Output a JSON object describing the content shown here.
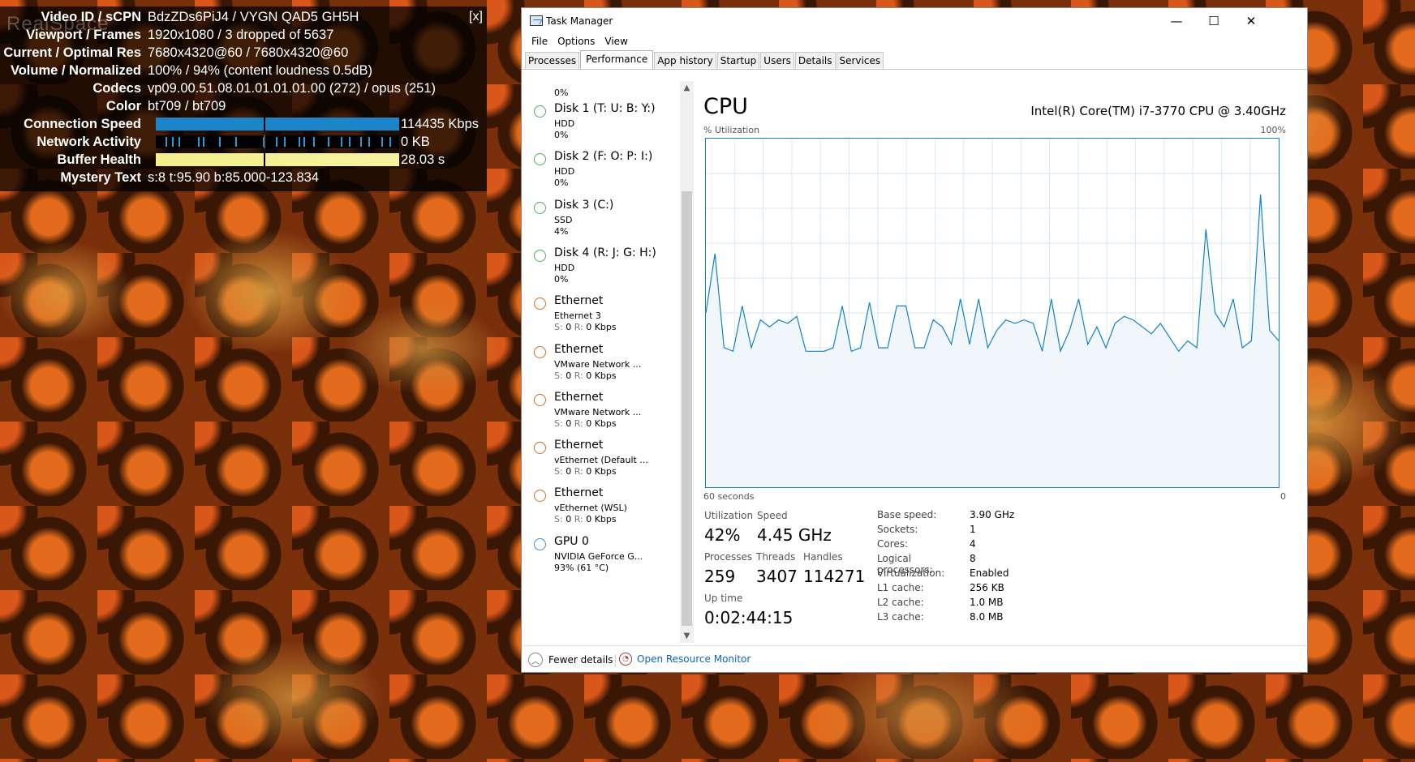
{
  "stats": {
    "ghost_text": "RealSpace",
    "close_label": "[x]",
    "rows": [
      {
        "label": "Video ID / sCPN",
        "value": "BdzZDs6PiJ4 / VYGN QAD5 GH5H"
      },
      {
        "label": "Viewport / Frames",
        "value": "1920x1080 / 3 dropped of 5637"
      },
      {
        "label": "Current / Optimal Res",
        "value": "7680x4320@60 / 7680x4320@60"
      },
      {
        "label": "Volume / Normalized",
        "value": "100% / 94% (content loudness 0.5dB)"
      },
      {
        "label": "Codecs",
        "value": "vp09.00.51.08.01.01.01.01.00 (272) / opus (251)"
      },
      {
        "label": "Color",
        "value": "bt709 / bt709"
      }
    ],
    "connection_speed": {
      "label": "Connection Speed",
      "value": "114435 Kbps"
    },
    "network_activity": {
      "label": "Network Activity",
      "value": "0 KB"
    },
    "buffer_health": {
      "label": "Buffer Health",
      "value": "28.03 s"
    },
    "mystery_text": {
      "label": "Mystery Text",
      "value": "s:8 t:95.90 b:85.000-123.834"
    },
    "colors": {
      "connection": "#1a86c9",
      "buffer": "#f2ef8a"
    }
  },
  "taskmanager": {
    "title": "Task Manager",
    "window_buttons": {
      "minimize": "—",
      "maximize": "☐",
      "close": "✕"
    },
    "menu": [
      "File",
      "Options",
      "View"
    ],
    "tabs": [
      {
        "label": "Processes",
        "active": false
      },
      {
        "label": "Performance",
        "active": true
      },
      {
        "label": "App history",
        "active": false
      },
      {
        "label": "Startup",
        "active": false
      },
      {
        "label": "Users",
        "active": false
      },
      {
        "label": "Details",
        "active": false
      },
      {
        "label": "Services",
        "active": false
      }
    ],
    "sidebar": {
      "top_value": "0%",
      "items": [
        {
          "name": "Disk 1 (T: U: B: Y:)",
          "sub": "HDD",
          "sub2": "0%",
          "color": "#4caf50"
        },
        {
          "name": "Disk 2 (F: O: P: I:)",
          "sub": "HDD",
          "sub2": "0%",
          "color": "#4caf50"
        },
        {
          "name": "Disk 3 (C:)",
          "sub": "SSD",
          "sub2": "4%",
          "color": "#4caf50"
        },
        {
          "name": "Disk 4 (R: J: G: H:)",
          "sub": "HDD",
          "sub2": "0%",
          "color": "#4caf50"
        },
        {
          "name": "Ethernet",
          "sub": "Ethernet 3",
          "sub2": "S: 0 R: 0 Kbps",
          "color": "#c8702a"
        },
        {
          "name": "Ethernet",
          "sub": "VMware Network ...",
          "sub2": "S: 0 R: 0 Kbps",
          "color": "#c8702a"
        },
        {
          "name": "Ethernet",
          "sub": "VMware Network ...",
          "sub2": "S: 0 R: 0 Kbps",
          "color": "#c8702a"
        },
        {
          "name": "Ethernet",
          "sub": "vEthernet (Default ...",
          "sub2": "S: 0 R: 0 Kbps",
          "color": "#c8702a"
        },
        {
          "name": "Ethernet",
          "sub": "vEthernet (WSL)",
          "sub2": "S: 0 R: 0 Kbps",
          "color": "#c8702a"
        },
        {
          "name": "GPU 0",
          "sub": "NVIDIA GeForce G...",
          "sub2": "93% (61 °C)",
          "color": "#3a8fd6"
        }
      ]
    },
    "cpu": {
      "title": "CPU",
      "model": "Intel(R) Core(TM) i7-3770 CPU @ 3.40GHz",
      "util_label": "% Utilization",
      "util_max": "100%",
      "axis_left": "60 seconds",
      "axis_right": "0",
      "utilization": {
        "label": "Utilization",
        "value": "42%"
      },
      "speed": {
        "label": "Speed",
        "value": "4.45 GHz"
      },
      "processes": {
        "label": "Processes",
        "value": "259"
      },
      "threads": {
        "label": "Threads",
        "value": "3407"
      },
      "handles": {
        "label": "Handles",
        "value": "114271"
      },
      "uptime": {
        "label": "Up time",
        "value": "0:02:44:15"
      },
      "specs": [
        {
          "k": "Base speed:",
          "v": "3.90 GHz"
        },
        {
          "k": "Sockets:",
          "v": "1"
        },
        {
          "k": "Cores:",
          "v": "4"
        },
        {
          "k": "Logical processors:",
          "v": "8"
        },
        {
          "k": "Virtualization:",
          "v": "Enabled"
        },
        {
          "k": "L1 cache:",
          "v": "256 KB"
        },
        {
          "k": "L2 cache:",
          "v": "1.0 MB"
        },
        {
          "k": "L3 cache:",
          "v": "8.0 MB"
        }
      ],
      "graph_color": "#1183c7",
      "graph_fill": "#f1f6fb",
      "history": [
        50,
        67,
        40,
        39,
        52,
        40,
        48,
        46,
        48,
        47,
        49,
        39,
        39,
        39,
        40,
        52,
        39,
        40,
        53,
        40,
        40,
        52,
        52,
        40,
        40,
        48,
        46,
        41,
        54,
        41,
        54,
        40,
        45,
        48,
        47,
        48,
        47,
        39,
        54,
        39,
        45,
        54,
        41,
        46,
        40,
        47,
        49,
        48,
        46,
        44,
        47,
        43,
        39,
        42,
        40,
        74,
        50,
        46,
        54,
        40,
        42,
        84,
        45,
        42
      ]
    },
    "bottom": {
      "fewer_details": "Fewer details",
      "open_resource_monitor": "Open Resource Monitor"
    }
  }
}
